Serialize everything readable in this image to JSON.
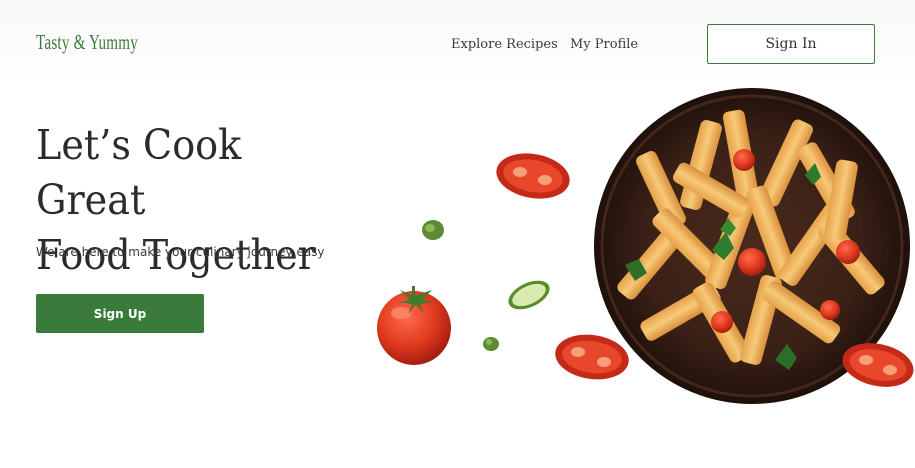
{
  "header": {
    "logo": "Tasty & Yummy",
    "nav": [
      {
        "label": "Explore Recipes"
      },
      {
        "label": "My Profile"
      }
    ],
    "signin_label": "Sign In"
  },
  "hero": {
    "title_line1": "Let’s Cook Great",
    "title_line2": "Food Together",
    "subtitle": "We are here to make your culinary journey easy",
    "signup_label": "Sign Up"
  },
  "colors": {
    "brand_green": "#3a7a3a",
    "text_dark": "#2b2b2b",
    "tomato_red": "#d8321e"
  },
  "icons": [
    "pasta-plate-image",
    "tomato-icon",
    "tomato-slice-icon",
    "cucumber-slice-icon",
    "basil-leaf-icon"
  ]
}
